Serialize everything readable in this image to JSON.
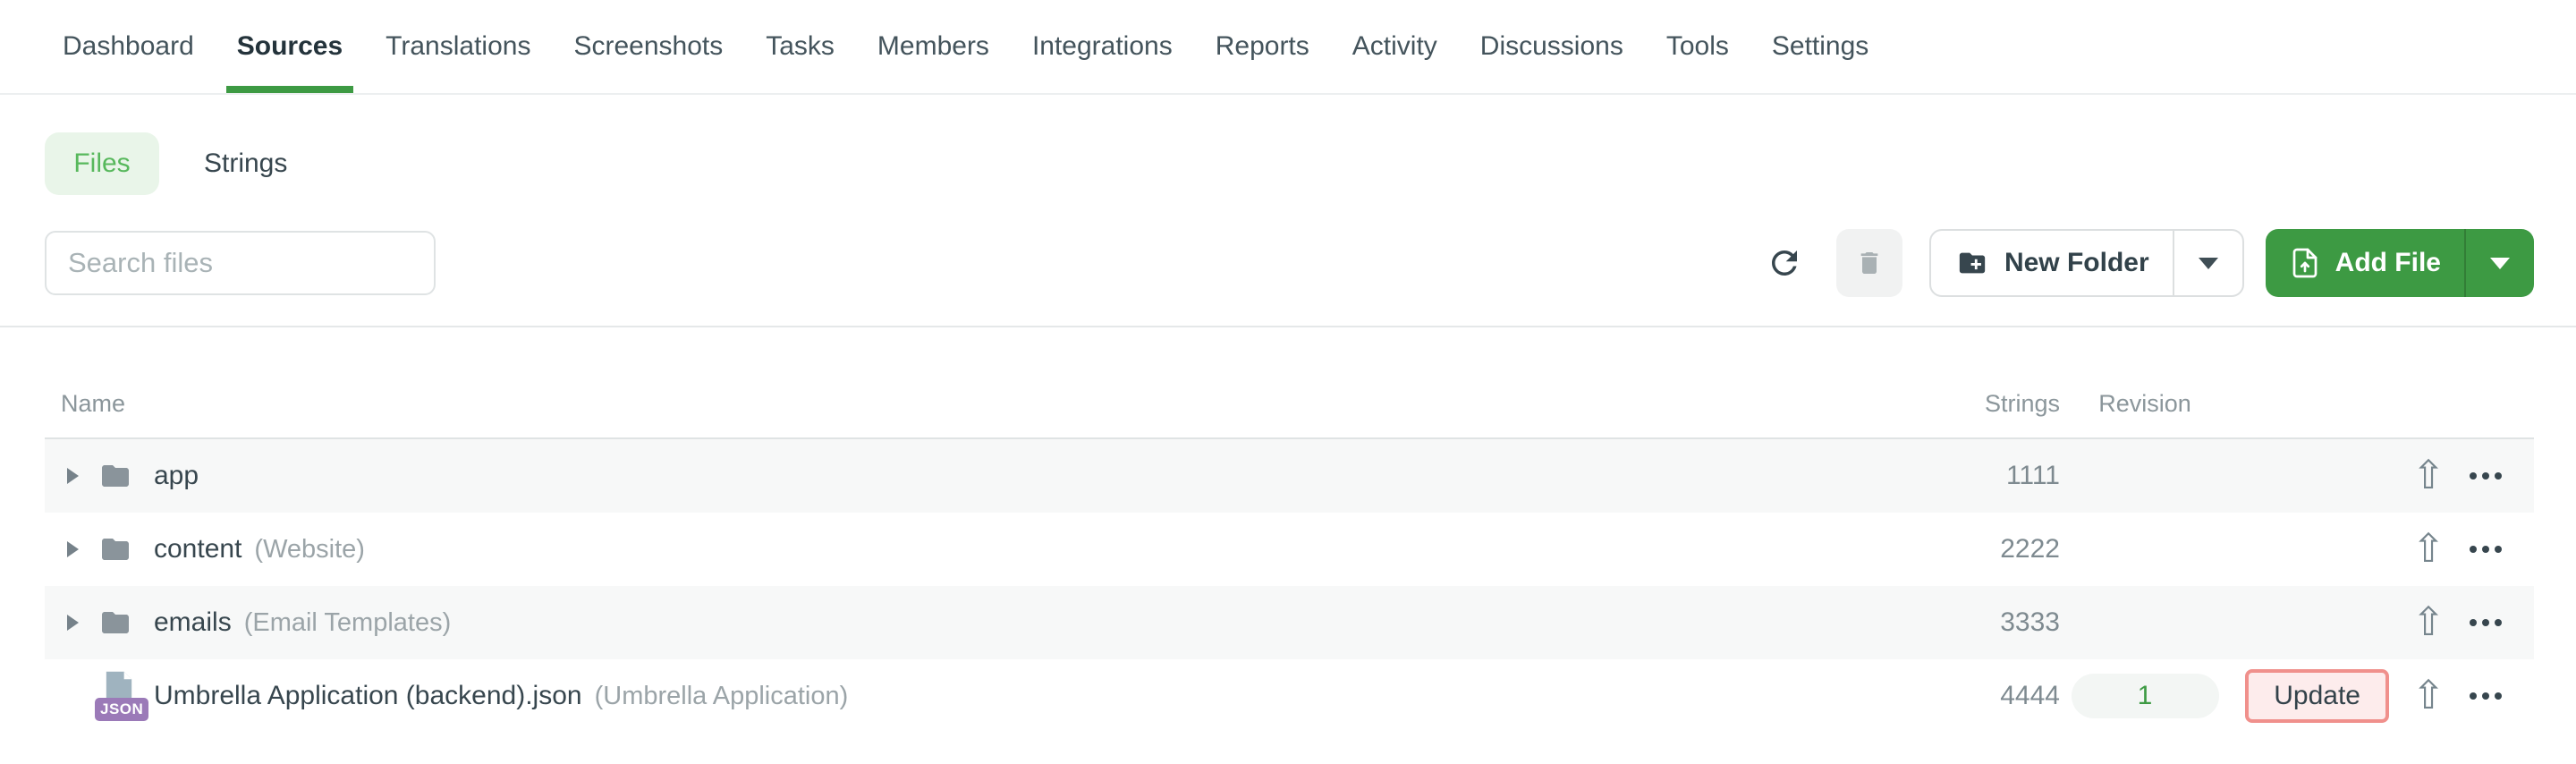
{
  "nav": {
    "items": [
      {
        "label": "Dashboard"
      },
      {
        "label": "Sources",
        "active": true
      },
      {
        "label": "Translations"
      },
      {
        "label": "Screenshots"
      },
      {
        "label": "Tasks"
      },
      {
        "label": "Members"
      },
      {
        "label": "Integrations"
      },
      {
        "label": "Reports"
      },
      {
        "label": "Activity"
      },
      {
        "label": "Discussions"
      },
      {
        "label": "Tools"
      },
      {
        "label": "Settings"
      }
    ]
  },
  "view_tabs": {
    "files_label": "Files",
    "strings_label": "Strings",
    "active": "Files"
  },
  "toolbar": {
    "search_placeholder": "Search files",
    "search_value": "",
    "new_folder_label": "New Folder",
    "add_file_label": "Add File"
  },
  "table": {
    "columns": {
      "name": "Name",
      "strings": "Strings",
      "revision": "Revision"
    },
    "rows": [
      {
        "type": "folder",
        "name": "app",
        "strings": "1111"
      },
      {
        "type": "folder",
        "name": "content",
        "note": "(Website)",
        "strings": "2222"
      },
      {
        "type": "folder",
        "name": "emails",
        "note": "(Email Templates)",
        "strings": "3333"
      },
      {
        "type": "file",
        "name": "Umbrella Application (backend).json",
        "note": "(Umbrella Application)",
        "strings": "4444",
        "revision": "1",
        "update_label": "Update",
        "badge": "JSON"
      }
    ]
  },
  "icons": {
    "upload": "⇧"
  },
  "colors": {
    "accent_green": "#3d9a43",
    "files_tab_text": "#57b85c",
    "files_tab_bg": "#e9f5e9",
    "add_file_bg": "#3d9a43",
    "update_border": "#f0908c",
    "update_bg": "#fdecec",
    "revision_pill_bg": "#f3f6f4",
    "json_badge_bg": "#9b7ab8",
    "row_stripe_bg": "#f7f8f8"
  }
}
